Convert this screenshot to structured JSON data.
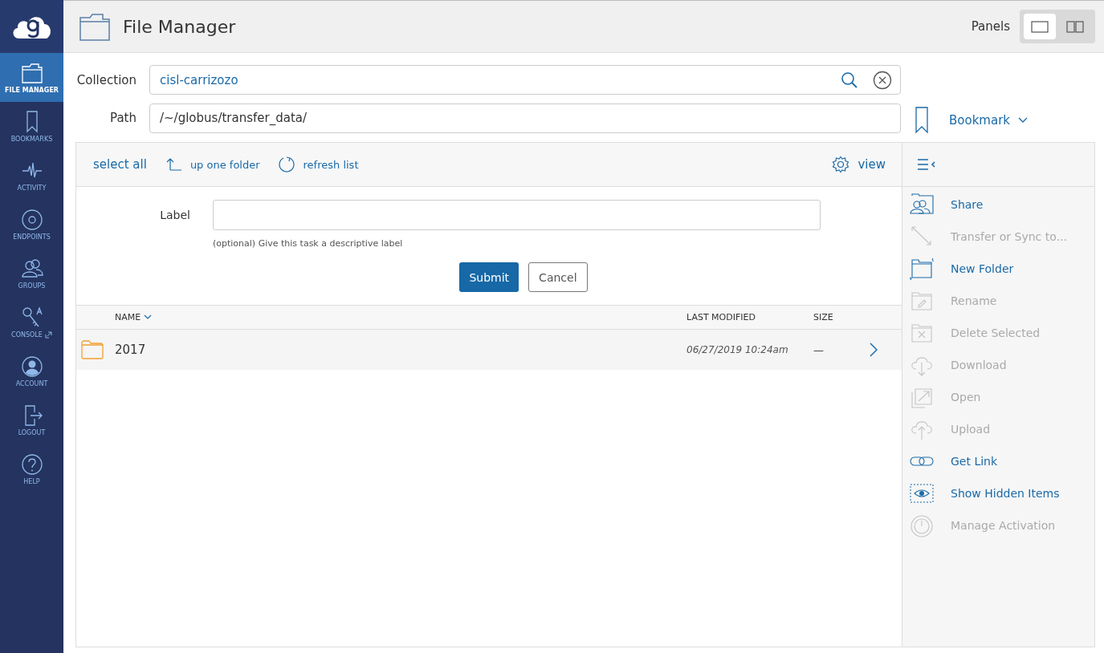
{
  "sidebar": {
    "items": [
      {
        "label": "FILE MANAGER",
        "selected": true
      },
      {
        "label": "BOOKMARKS",
        "selected": false
      },
      {
        "label": "ACTIVITY",
        "selected": false
      },
      {
        "label": "ENDPOINTS",
        "selected": false
      },
      {
        "label": "GROUPS",
        "selected": false
      },
      {
        "label": "CONSOLE",
        "selected": false
      },
      {
        "label": "ACCOUNT",
        "selected": false
      },
      {
        "label": "LOGOUT",
        "selected": false
      },
      {
        "label": "HELP",
        "selected": false
      }
    ]
  },
  "header": {
    "title": "File Manager",
    "panels_label": "Panels",
    "panel_modes": [
      {
        "selected": true
      },
      {
        "selected": false
      }
    ]
  },
  "collection": {
    "label": "Collection",
    "value": "cisl-carrizozo"
  },
  "path": {
    "label": "Path",
    "value": "/~/globus/transfer_data/"
  },
  "bookmark": {
    "label": "Bookmark"
  },
  "toolbar": {
    "select_all": "select all",
    "up": "up one folder",
    "refresh": "refresh list",
    "view": "view"
  },
  "label_form": {
    "label": "Label",
    "help": "(optional) Give this task a descriptive label",
    "submit": "Submit",
    "cancel": "Cancel"
  },
  "table": {
    "columns": [
      "NAME",
      "LAST MODIFIED",
      "SIZE"
    ],
    "rows": [
      {
        "name": "2017",
        "modified": "06/27/2019 10:24am",
        "size": "—"
      }
    ]
  },
  "actions": [
    {
      "label": "Share",
      "disabled": false
    },
    {
      "label": "Transfer or Sync to...",
      "disabled": true
    },
    {
      "label": "New Folder",
      "disabled": false
    },
    {
      "label": "Rename",
      "disabled": true
    },
    {
      "label": "Delete Selected",
      "disabled": true
    },
    {
      "label": "Download",
      "disabled": true
    },
    {
      "label": "Open",
      "disabled": true
    },
    {
      "label": "Upload",
      "disabled": true
    },
    {
      "label": "Get Link",
      "disabled": false
    },
    {
      "label": "Show Hidden Items",
      "disabled": false
    },
    {
      "label": "Manage Activation",
      "disabled": true
    }
  ]
}
